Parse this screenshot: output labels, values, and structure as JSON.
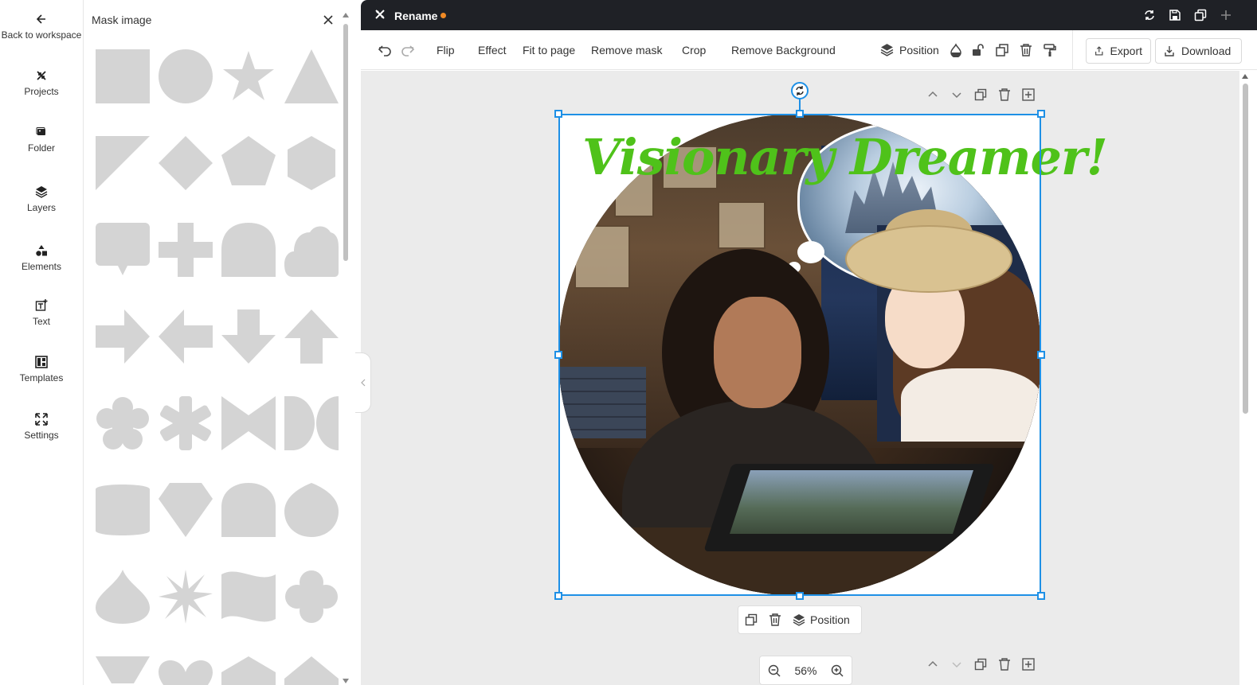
{
  "nav": {
    "back": "Back to workspace",
    "items": [
      {
        "label": "Projects",
        "icon": "projects-icon"
      },
      {
        "label": "Folder",
        "icon": "image-icon"
      },
      {
        "label": "Layers",
        "icon": "layers-icon"
      },
      {
        "label": "Elements",
        "icon": "elements-icon"
      },
      {
        "label": "Text",
        "icon": "text-icon"
      },
      {
        "label": "Templates",
        "icon": "templates-icon"
      },
      {
        "label": "Settings",
        "icon": "resize-icon"
      }
    ]
  },
  "panel": {
    "title": "Mask image",
    "shapes": [
      "square",
      "circle",
      "star",
      "triangle",
      "right-triangle",
      "diamond",
      "pentagon",
      "hexagon",
      "speech-bubble",
      "cross",
      "arch",
      "cloud",
      "arrow-right",
      "arrow-left",
      "arrow-down",
      "arrow-up",
      "flower-5",
      "asterisk",
      "bookmark",
      "crescent-pair",
      "rounded-cylinder",
      "gem",
      "tombstone",
      "drop-left",
      "drop-up",
      "starburst",
      "wave-flag",
      "flower-4",
      "shield",
      "heart",
      "house",
      "roof"
    ]
  },
  "topbar": {
    "title": "Rename",
    "unsaved_color": "#f08a24"
  },
  "toolbar": {
    "flip": "Flip",
    "effect": "Effect",
    "fit_to_page": "Fit to page",
    "remove_mask": "Remove mask",
    "crop": "Crop",
    "remove_background": "Remove Background",
    "position": "Position",
    "export": "Export",
    "download": "Download"
  },
  "canvas": {
    "banner_text": "Visionary Dreamer!",
    "banner_color": "#4fc21a",
    "selection_color": "#1e90e6",
    "float_position": "Position",
    "zoom": "56%"
  }
}
